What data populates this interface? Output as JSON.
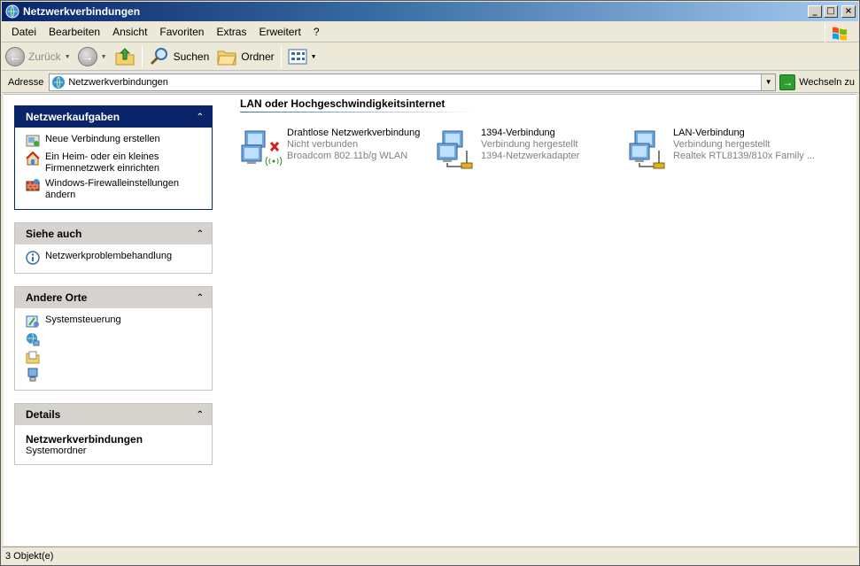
{
  "window": {
    "title": "Netzwerkverbindungen"
  },
  "menubar": {
    "items": [
      "Datei",
      "Bearbeiten",
      "Ansicht",
      "Favoriten",
      "Extras",
      "Erweitert",
      "?"
    ]
  },
  "toolbar": {
    "back_label": "Zurück",
    "search_label": "Suchen",
    "folders_label": "Ordner"
  },
  "addressbar": {
    "label": "Adresse",
    "value": "Netzwerkverbindungen",
    "go_label": "Wechseln zu"
  },
  "taskpane": {
    "network_tasks": {
      "title": "Netzwerkaufgaben",
      "items": [
        {
          "label": "Neue Verbindung erstellen",
          "icon": "new-connection-icon"
        },
        {
          "label": "Ein Heim- oder ein kleines Firmennetzwerk einrichten",
          "icon": "home-network-icon"
        },
        {
          "label": "Windows-Firewalleinstellungen ändern",
          "icon": "firewall-icon"
        }
      ]
    },
    "see_also": {
      "title": "Siehe auch",
      "items": [
        {
          "label": "Netzwerkproblembehandlung",
          "icon": "info-icon"
        }
      ]
    },
    "other_places": {
      "title": "Andere Orte",
      "items": [
        {
          "label": "Systemsteuerung",
          "icon": "control-panel-icon"
        },
        {
          "label": "",
          "icon": "network-places-icon"
        },
        {
          "label": "",
          "icon": "documents-icon"
        },
        {
          "label": "",
          "icon": "computer-icon"
        }
      ]
    },
    "details": {
      "title": "Details",
      "name": "Netzwerkverbindungen",
      "type": "Systemordner"
    }
  },
  "main": {
    "group_title": "LAN oder Hochgeschwindigkeitsinternet",
    "connections": [
      {
        "name": "Drahtlose Netzwerkverbindung",
        "status": "Nicht verbunden",
        "device": "Broadcom 802.11b/g WLAN",
        "icon": "wireless-connection-icon"
      },
      {
        "name": "1394-Verbindung",
        "status": "Verbindung hergestellt",
        "device": "1394-Netzwerkadapter",
        "icon": "1394-connection-icon"
      },
      {
        "name": "LAN-Verbindung",
        "status": "Verbindung hergestellt",
        "device": "Realtek RTL8139/810x Family ...",
        "icon": "lan-connection-icon"
      }
    ]
  },
  "statusbar": {
    "text": "3 Objekt(e)"
  },
  "colors": {
    "title_start": "#0a246a",
    "title_end": "#a6caf0",
    "taskpane_header": "#0a246a",
    "chrome": "#ece9d8"
  }
}
